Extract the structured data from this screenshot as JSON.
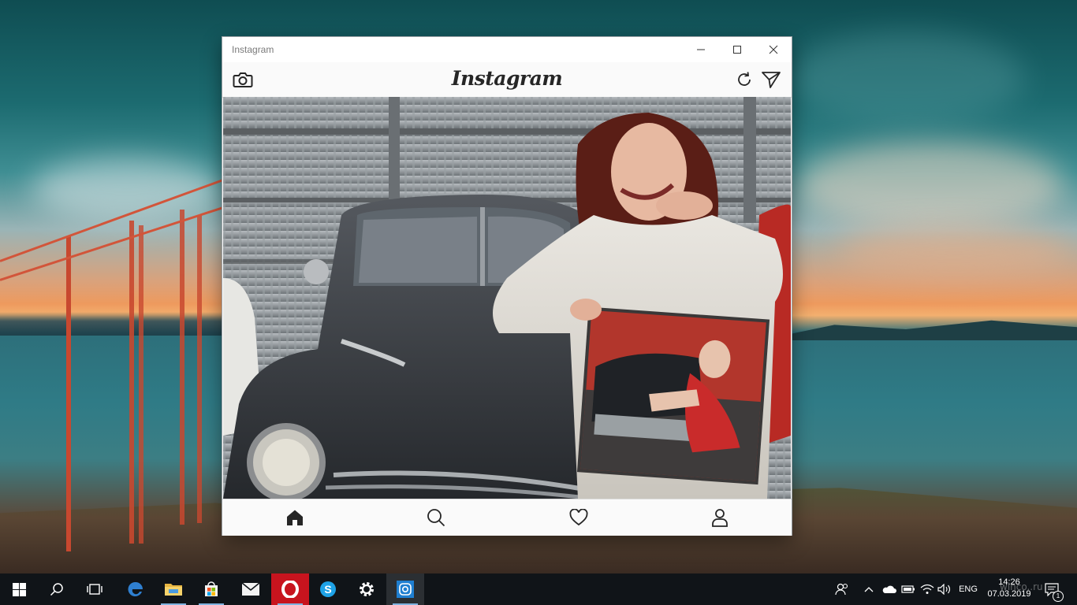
{
  "window": {
    "title": "Instagram",
    "minimize_icon": "minimize-icon",
    "maximize_icon": "maximize-icon",
    "close_icon": "close-icon"
  },
  "app": {
    "logo": "Instagram",
    "camera_icon": "camera-icon",
    "refresh_icon": "refresh-icon",
    "direct_icon": "paper-plane-icon"
  },
  "post": {
    "image_description_icon": "photo"
  },
  "nav": {
    "home_icon": "home-icon",
    "search_icon": "search-icon",
    "activity_icon": "heart-icon",
    "profile_icon": "profile-icon",
    "active": "home"
  },
  "taskbar": {
    "apps": [
      "start",
      "search",
      "task-view",
      "edge",
      "file-explorer",
      "store",
      "mail",
      "opera",
      "skype",
      "settings",
      "instagram"
    ],
    "tray_language": "ENG",
    "clock_time": "14:26",
    "clock_date": "07.03.2019",
    "notification_count": "1"
  },
  "watermark": "winco..ru",
  "colors": {
    "accent_taskbar": "#7fb3e0",
    "opera_red": "#c8141e",
    "edge_blue": "#2f80d1",
    "skype_blue": "#1ea2e6"
  }
}
